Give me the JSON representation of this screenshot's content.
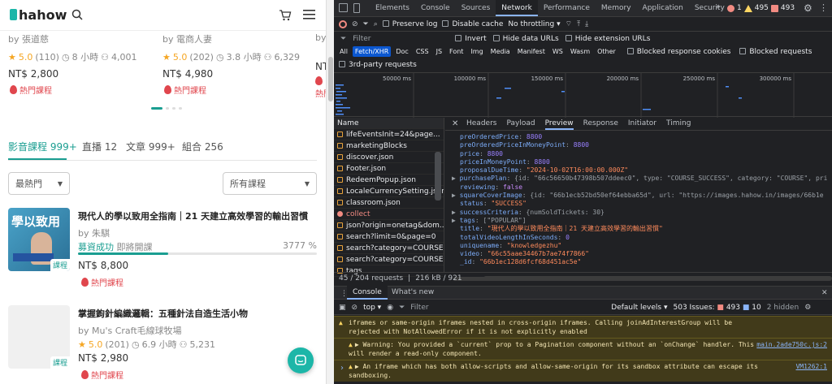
{
  "site": {
    "logo": "hahow",
    "top_cards": [
      {
        "by": "by 張道慈",
        "rating": "5.0",
        "reviews": "(110)",
        "hours": "8 小時",
        "students": "4,001",
        "price": "NT$ 2,800",
        "hot": "熱門課程"
      },
      {
        "by": "by 電商人妻",
        "rating": "5.0",
        "reviews": "(202)",
        "hours": "3.8 小時",
        "students": "6,329",
        "price": "NT$ 4,980",
        "hot": "熱門課程"
      },
      {
        "by": "by",
        "rating": "",
        "reviews": "",
        "hours": "",
        "students": "",
        "price": "NT$",
        "hot": "熱門"
      }
    ],
    "tabs": [
      "影音課程 999+",
      "直播 12",
      "文章 999+",
      "組合 256"
    ],
    "sort_select": "最熱門",
    "filter_select": "所有課程",
    "courses": [
      {
        "title": "現代人的學以致用全指南｜21 天建立高效學習的輸出習慣",
        "by": "by 朱騏",
        "status": "募資成功",
        "status2": "即將開課",
        "progress": "3777 %",
        "progress_value": 37.77,
        "price": "NT$ 8,800",
        "hot": "熱門課程",
        "badge": "課程",
        "thumb_text": "學以致用"
      },
      {
        "title": "掌握鉤針編織邏輯：五種針法自造生活小物",
        "by": "by Mu's Craft毛線球牧場",
        "rating": "5.0",
        "reviews": "(201)",
        "hours": "6.9 小時",
        "students": "5,231",
        "price": "NT$ 2,980",
        "hot": "熱門課程",
        "badge": "課程"
      }
    ]
  },
  "devtools": {
    "tabs": [
      "Elements",
      "Console",
      "Sources",
      "Network",
      "Performance",
      "Memory",
      "Application",
      "Security"
    ],
    "active_tab": "Network",
    "error_count": "1",
    "warn_count": "495",
    "issues_count": "493",
    "preserve_log": "Preserve log",
    "disable_cache": "Disable cache",
    "throttling": "No throttling",
    "filter_placeholder": "Filter",
    "invert": "Invert",
    "hide_data_urls": "Hide data URLs",
    "hide_ext_urls": "Hide extension URLs",
    "type_chips": [
      "All",
      "Fetch/XHR",
      "Doc",
      "CSS",
      "JS",
      "Font",
      "Img",
      "Media",
      "Manifest",
      "WS",
      "Wasm",
      "Other"
    ],
    "active_chip": "Fetch/XHR",
    "blocked_cookies": "Blocked response cookies",
    "blocked_requests": "Blocked requests",
    "third_party": "3rd-party requests",
    "timeline_ticks": [
      "50000 ms",
      "100000 ms",
      "150000 ms",
      "200000 ms",
      "250000 ms",
      "300000 ms"
    ],
    "name_header": "Name",
    "requests": [
      "lifeEventsInit=24&page...",
      "marketingBlocks",
      "discover.json",
      "Footer.json",
      "RedeemPopup.json",
      "LocaleCurrencySetting.json",
      "classroom.json",
      "collect",
      "json?origin=onetag&dom...",
      "search?limit=0&page=0",
      "search?category=COURSE...",
      "search?category=COURSE...",
      "tags"
    ],
    "summary": "45 / 204 requests",
    "transferred": "216 kB / 921",
    "detail_tabs": [
      "Headers",
      "Payload",
      "Preview",
      "Response",
      "Initiator",
      "Timing"
    ],
    "active_detail_tab": "Preview",
    "preview_lines": [
      {
        "t": "kv",
        "k": "preOrderedPrice",
        "v": "8800",
        "c": "num"
      },
      {
        "t": "kv",
        "k": "preOrderedPriceInMoneyPoint",
        "v": "8800",
        "c": "num"
      },
      {
        "t": "kv",
        "k": "price",
        "v": "8800",
        "c": "num"
      },
      {
        "t": "kv",
        "k": "priceInMoneyPoint",
        "v": "8800",
        "c": "num"
      },
      {
        "t": "kv",
        "k": "proposalDueTime",
        "v": "\"2024-10-02T16:00:00.000Z\"",
        "c": "str"
      },
      {
        "t": "obj",
        "k": "purchasePlan",
        "v": "{id: \"66c56650b47398b507ddeec0\", type: \"COURSE_SUCCESS\", category: \"COURSE\", pri"
      },
      {
        "t": "kv",
        "k": "reviewing",
        "v": "false",
        "c": "sv"
      },
      {
        "t": "obj",
        "k": "squareCoverImage",
        "v": "{id: \"66b1ecb52bd50ef64ebba65d\", url: \"https://images.hahow.in/images/66b1e"
      },
      {
        "t": "kv",
        "k": "status",
        "v": "\"SUCCESS\"",
        "c": "str"
      },
      {
        "t": "obj",
        "k": "successCriteria",
        "v": "{numSoldTickets: 30}"
      },
      {
        "t": "obj",
        "k": "tags",
        "v": "[\"POPULAR\"]"
      },
      {
        "t": "kv",
        "k": "title",
        "v": "\"現代人的學以致用全指南｜21 天建立高效學習的輸出習慣\"",
        "c": "str"
      },
      {
        "t": "kv",
        "k": "totalVideoLengthInSeconds",
        "v": "0",
        "c": "num"
      },
      {
        "t": "kv",
        "k": "uniquename",
        "v": "\"knowledgezhu\"",
        "c": "str"
      },
      {
        "t": "kv",
        "k": "video",
        "v": "\"66c55aae34467b7ae74f7866\"",
        "c": "str"
      },
      {
        "t": "kv",
        "k": "_id",
        "v": "\"66b1ec128d6fcf68d451ac5e\"",
        "c": "str"
      }
    ],
    "console_tabs": [
      "Console",
      "What's new"
    ],
    "console_context": "top",
    "console_filter": "Filter",
    "log_levels": "Default levels",
    "issues_label": "503 Issues:",
    "issues_warn": "493",
    "issues_info": "10",
    "hidden": "2 hidden",
    "messages": [
      {
        "text": "iframes or same-origin iframes nested in cross-origin iframes. Calling joinAdInterestGroup will be rejected with NotAllowedError if it is not explicitly enabled",
        "src": ""
      },
      {
        "text": "▶ Warning: You provided a `current` prop to a Pagination component without an `onChange` handler. This will render a read-only component.",
        "src": "main.2ade750c.js:2"
      },
      {
        "text": "▶ An iframe which has both allow-scripts and allow-same-origin for its sandbox attribute can escape its sandboxing.",
        "src": "VM1262:1"
      }
    ]
  }
}
